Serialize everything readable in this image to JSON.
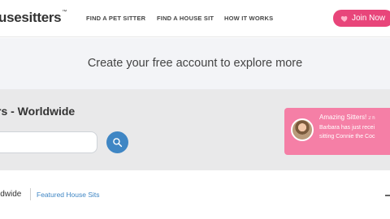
{
  "header": {
    "logo_text": "usesitters",
    "logo_tm": "™",
    "nav": [
      {
        "label": "FIND A PET SITTER"
      },
      {
        "label": "FIND A HOUSE SIT"
      },
      {
        "label": "HOW IT WORKS"
      }
    ],
    "join_label": "Join Now",
    "join_color": "#e8457a"
  },
  "banner": {
    "text": "Create your free account to explore more"
  },
  "search": {
    "title": "rs - Worldwide",
    "input_value": "",
    "button_icon": "search-icon",
    "button_color": "#3f86c4"
  },
  "notification": {
    "title": "Amazing Sitters!",
    "time": "2 h",
    "line1": "Barbara has just recei",
    "line2": "sitting Connie the Coc",
    "color": "#f57fa6"
  },
  "tabs": {
    "active": "ldwide",
    "featured": "Featured House Sits"
  }
}
